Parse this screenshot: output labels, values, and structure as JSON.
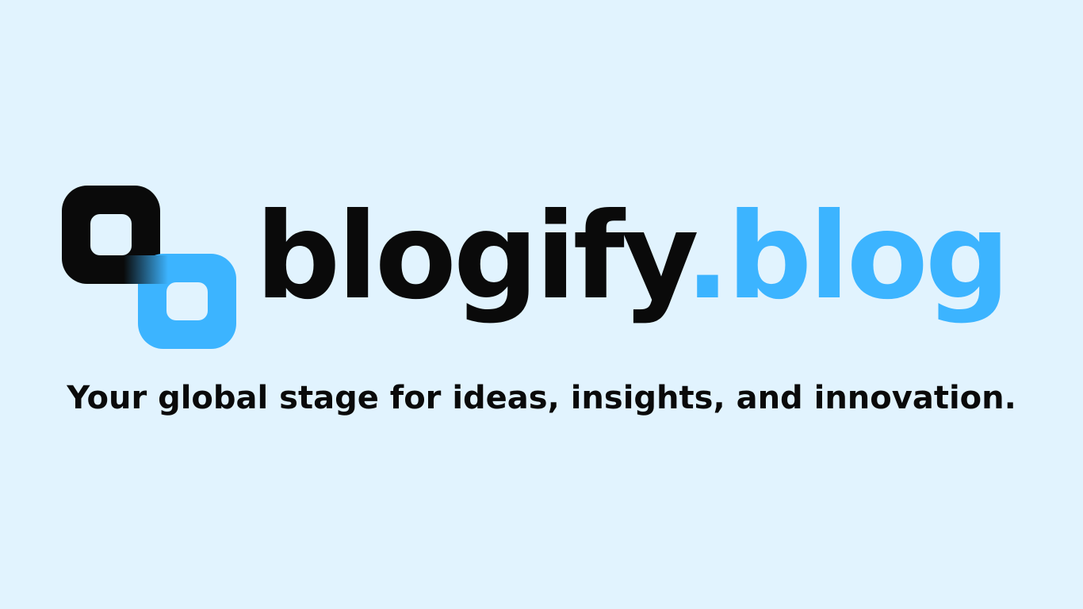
{
  "brand": {
    "name_primary": "blogify",
    "name_suffix": ".blog",
    "tagline": "Your global stage for ideas, insights, and innovation."
  },
  "colors": {
    "background": "#E1F3FE",
    "text_dark": "#0A0A0A",
    "accent_blue": "#3CB4FF"
  },
  "icons": {
    "logo": "linked-rounded-squares-logo-icon"
  }
}
